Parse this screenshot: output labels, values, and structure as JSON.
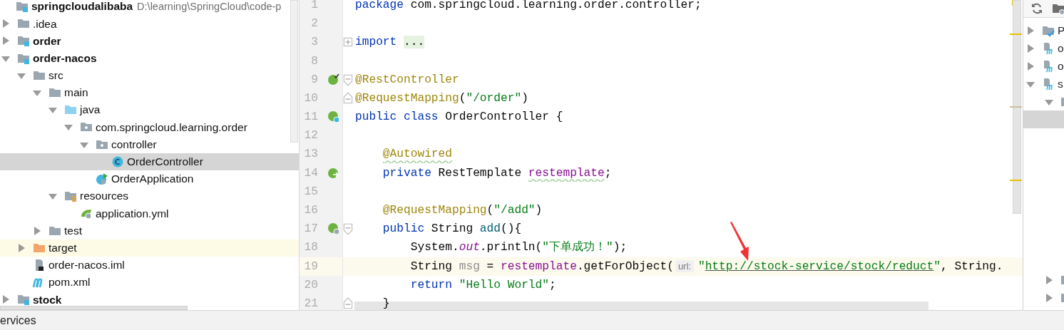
{
  "project_tree": {
    "label": "springcloudalibaba",
    "path": "D:\\learning\\SpringCloud\\code-p",
    "kind": "module",
    "bold": true,
    "children": [
      {
        "label": ".idea",
        "kind": "folder",
        "expanded": false
      },
      {
        "label": "order",
        "kind": "module",
        "bold": true,
        "expanded": false
      },
      {
        "label": "order-nacos",
        "kind": "module",
        "bold": true,
        "expanded": true,
        "children": [
          {
            "label": "src",
            "kind": "folder",
            "expanded": true,
            "children": [
              {
                "label": "main",
                "kind": "folder",
                "expanded": true,
                "children": [
                  {
                    "label": "java",
                    "kind": "source-folder",
                    "expanded": true,
                    "children": [
                      {
                        "label": "com.springcloud.learning.order",
                        "kind": "package",
                        "expanded": true,
                        "children": [
                          {
                            "label": "controller",
                            "kind": "package",
                            "expanded": true,
                            "children": [
                              {
                                "label": "OrderController",
                                "kind": "class",
                                "selected": true
                              }
                            ]
                          },
                          {
                            "label": "OrderApplication",
                            "kind": "spring-app",
                            "selected": false
                          }
                        ]
                      }
                    ]
                  },
                  {
                    "label": "resources",
                    "kind": "resources",
                    "expanded": true,
                    "children": [
                      {
                        "label": "application.yml",
                        "kind": "yml",
                        "selected": false
                      }
                    ]
                  }
                ]
              },
              {
                "label": "test",
                "kind": "folder",
                "expanded": false
              }
            ]
          },
          {
            "label": "target",
            "kind": "excluded",
            "expanded": false,
            "highlighted": true
          },
          {
            "label": "order-nacos.iml",
            "kind": "iml",
            "selected": false
          },
          {
            "label": "pom.xml",
            "kind": "maven",
            "selected": false
          }
        ]
      },
      {
        "label": "stock",
        "kind": "module",
        "bold": true,
        "expanded": false
      }
    ]
  },
  "editor": {
    "lines": [
      {
        "number": "1",
        "kind": "top",
        "tokens": [
          {
            "text": "package",
            "kind": "keyword"
          },
          {
            "text": " com.springcloud.learning.order.controller;",
            "kind": "plain"
          }
        ]
      },
      {
        "number": "2"
      },
      {
        "number": "3",
        "kind": "top",
        "fold_marker": {
          "kind": "collapsed"
        },
        "tokens": [
          {
            "text": "import ",
            "kind": "keyword"
          },
          {
            "text": "...",
            "kind": "folded"
          }
        ]
      },
      {
        "number": "8"
      },
      {
        "number": "9",
        "kind": "top",
        "gutter_icon": {
          "kind": "bean-check"
        },
        "fold_marker": {
          "kind": "start"
        },
        "tokens": [
          {
            "text": "@RestController",
            "kind": "annotation"
          }
        ]
      },
      {
        "number": "10",
        "kind": "top",
        "fold_marker": {
          "kind": "end"
        },
        "tokens": [
          {
            "text": "@RequestMapping",
            "kind": "annotation"
          },
          {
            "text": "(",
            "kind": "plain"
          },
          {
            "text": "\"/order\"",
            "kind": "string"
          },
          {
            "text": ")",
            "kind": "plain"
          }
        ]
      },
      {
        "number": "11",
        "kind": "top",
        "gutter_icon": {
          "kind": "bean-class"
        },
        "tokens": [
          {
            "text": "public class",
            "kind": "keyword"
          },
          {
            "text": " OrderController {",
            "kind": "plain"
          }
        ]
      },
      {
        "number": "12"
      },
      {
        "number": "13",
        "kind": "member",
        "tokens": [
          {
            "text": "@Autowired",
            "kind": "annotation",
            "warning": true
          }
        ]
      },
      {
        "number": "14",
        "kind": "member",
        "gutter_icon": {
          "kind": "autowired"
        },
        "tokens": [
          {
            "text": "private",
            "kind": "keyword"
          },
          {
            "text": " RestTemplate ",
            "kind": "plain"
          },
          {
            "text": "restemplate",
            "kind": "field",
            "warning": true
          },
          {
            "text": ";",
            "kind": "plain"
          }
        ]
      },
      {
        "number": "15"
      },
      {
        "number": "16",
        "kind": "member",
        "tokens": [
          {
            "text": "@RequestMapping",
            "kind": "annotation"
          },
          {
            "text": "(",
            "kind": "plain"
          },
          {
            "text": "\"/add\"",
            "kind": "string"
          },
          {
            "text": ")",
            "kind": "plain"
          }
        ]
      },
      {
        "number": "17",
        "kind": "member",
        "gutter_icon": {
          "kind": "endpoint"
        },
        "fold_marker": {
          "kind": "start"
        },
        "tokens": [
          {
            "text": "public",
            "kind": "keyword"
          },
          {
            "text": " String ",
            "kind": "plain"
          },
          {
            "text": "add",
            "kind": "method"
          },
          {
            "text": "(){",
            "kind": "plain"
          }
        ]
      },
      {
        "number": "18",
        "kind": "statement",
        "tokens": [
          {
            "text": "System.",
            "kind": "plain"
          },
          {
            "text": "out",
            "kind": "static"
          },
          {
            "text": ".println(",
            "kind": "plain"
          },
          {
            "text": "\"下单成功！\"",
            "kind": "string"
          },
          {
            "text": ");",
            "kind": "plain"
          }
        ]
      },
      {
        "number": "19",
        "kind": "statement",
        "current": true,
        "tokens": [
          {
            "text": "String ",
            "kind": "plain"
          },
          {
            "text": "msg",
            "kind": "unused"
          },
          {
            "text": " = ",
            "kind": "plain"
          },
          {
            "text": "restemplate",
            "kind": "field"
          },
          {
            "text": ".getForObject(",
            "kind": "plain"
          },
          {
            "text": "url:",
            "kind": "hint"
          },
          {
            "text": "\"",
            "kind": "string"
          },
          {
            "text": "http://stock-service/stock/reduct",
            "kind": "link"
          },
          {
            "text": "\"",
            "kind": "string"
          },
          {
            "text": ", String.",
            "kind": "plain"
          }
        ]
      },
      {
        "number": "20",
        "kind": "statement",
        "tokens": [
          {
            "text": "return",
            "kind": "keyword"
          },
          {
            "text": " \"Hello World\"",
            "kind": "string"
          },
          {
            "text": ";",
            "kind": "plain"
          }
        ]
      },
      {
        "number": "21",
        "kind": "member",
        "fold_marker": {
          "kind": "end"
        },
        "tokens": [
          {
            "text": "}",
            "kind": "plain"
          }
        ]
      }
    ]
  },
  "maven": {
    "rows": [
      {
        "label": "P",
        "kind": "profiles",
        "expanded": false
      },
      {
        "label": "o",
        "kind": "maven-module",
        "expanded": false
      },
      {
        "label": "o",
        "kind": "maven-module",
        "expanded": false
      },
      {
        "label": "s",
        "kind": "maven-module",
        "expanded": true,
        "children": [
          {
            "kind": "folder",
            "expanded": true
          },
          {
            "selected": true
          }
        ]
      }
    ],
    "lower_rows": [
      {
        "kind": "folder",
        "expanded": false
      },
      {
        "kind": "folder",
        "expanded": false
      }
    ]
  },
  "bottom_bar": {
    "tab": "ervices"
  }
}
